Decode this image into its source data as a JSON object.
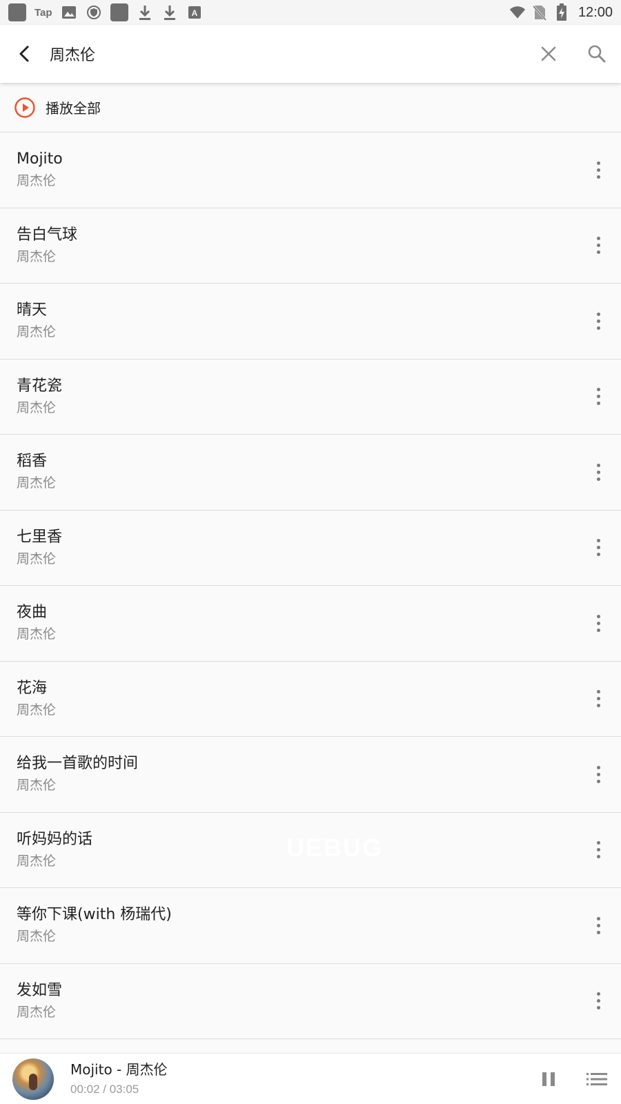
{
  "status_bar": {
    "tap_label": "Tap",
    "time": "12:00"
  },
  "search": {
    "query": "周杰伦"
  },
  "play_all": {
    "label": "播放全部",
    "accent_color": "#f0522d"
  },
  "songs": [
    {
      "title": "Mojito",
      "artist": "周杰伦"
    },
    {
      "title": "告白气球",
      "artist": "周杰伦"
    },
    {
      "title": "晴天",
      "artist": "周杰伦"
    },
    {
      "title": "青花瓷",
      "artist": "周杰伦"
    },
    {
      "title": "稻香",
      "artist": "周杰伦"
    },
    {
      "title": "七里香",
      "artist": "周杰伦"
    },
    {
      "title": "夜曲",
      "artist": "周杰伦"
    },
    {
      "title": "花海",
      "artist": "周杰伦"
    },
    {
      "title": "给我一首歌的时间",
      "artist": "周杰伦"
    },
    {
      "title": "听妈妈的话",
      "artist": "周杰伦"
    },
    {
      "title": "等你下课(with 杨瑞代)",
      "artist": "周杰伦"
    },
    {
      "title": "发如雪",
      "artist": "周杰伦"
    }
  ],
  "watermark": "UEBUG",
  "player": {
    "title": "Mojito - 周杰伦",
    "time": "00:02 / 03:05"
  },
  "icons": {
    "back": "arrow-back-icon",
    "clear": "close-icon",
    "search": "search-icon",
    "play_all": "play-circle-icon",
    "more": "more-vert-icon",
    "pause": "pause-icon",
    "playlist": "playlist-icon"
  }
}
